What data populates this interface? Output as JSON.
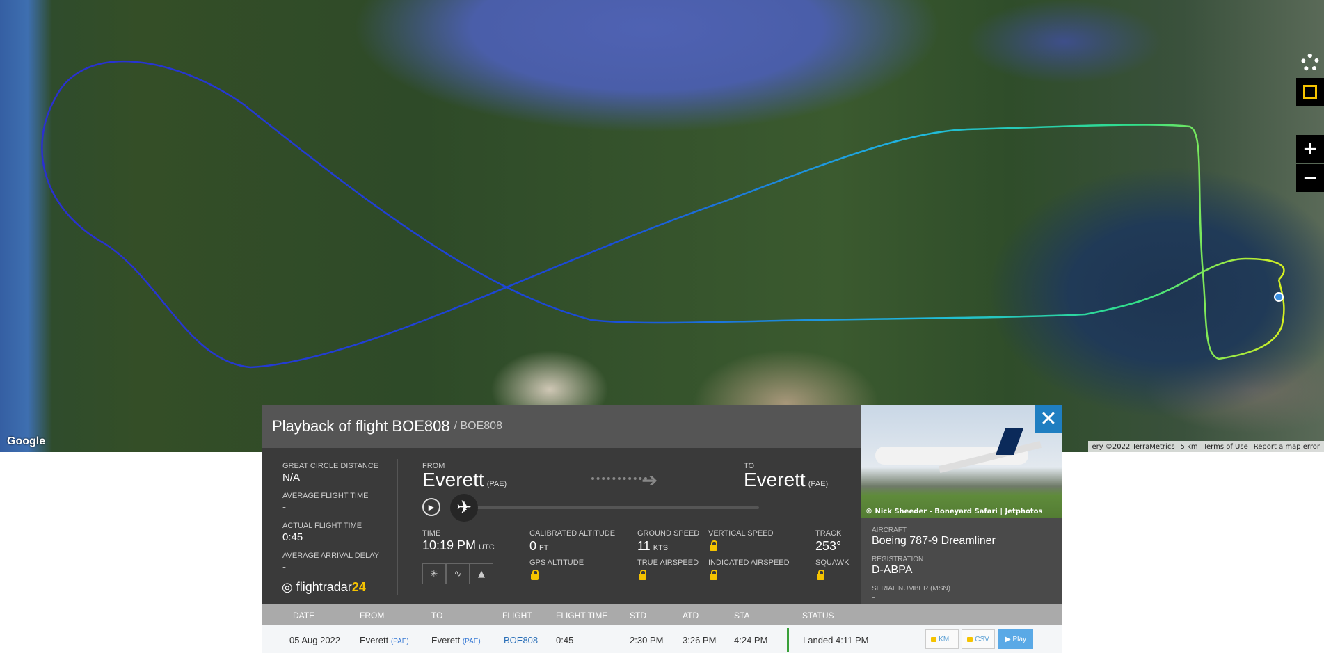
{
  "map": {
    "google_logo": "Google",
    "credits": [
      "ery ©2022 TerraMetrics",
      "5 km",
      "Terms of Use",
      "Report a map error"
    ],
    "zoom_in": "+",
    "zoom_out": "−"
  },
  "panel": {
    "title": "Playback of flight BOE808",
    "subtitle": "/ BOE808",
    "close_label": "✕",
    "stats": [
      {
        "label": "GREAT CIRCLE DISTANCE",
        "value": "N/A"
      },
      {
        "label": "AVERAGE FLIGHT TIME",
        "value": "-"
      },
      {
        "label": "ACTUAL FLIGHT TIME",
        "value": "0:45"
      },
      {
        "label": "AVERAGE ARRIVAL DELAY",
        "value": "-"
      }
    ],
    "brand": {
      "name": "flightradar",
      "number": "24"
    },
    "from": {
      "label": "FROM",
      "city": "Everett",
      "code": "(PAE)"
    },
    "to": {
      "label": "TO",
      "city": "Everett",
      "code": "(PAE)"
    },
    "time": {
      "label": "TIME",
      "value": "10:19 PM",
      "unit": "UTC"
    },
    "calibrated_altitude": {
      "label": "CALIBRATED ALTITUDE",
      "value": "0",
      "unit": "FT"
    },
    "gps_altitude": {
      "label": "GPS ALTITUDE"
    },
    "ground_speed": {
      "label": "GROUND SPEED",
      "value": "11",
      "unit": "KTS"
    },
    "true_airspeed": {
      "label": "TRUE AIRSPEED"
    },
    "vertical_speed": {
      "label": "VERTICAL SPEED"
    },
    "indicated_airspeed": {
      "label": "INDICATED AIRSPEED"
    },
    "track": {
      "label": "TRACK",
      "value": "253°"
    },
    "squawk": {
      "label": "SQUAWK"
    },
    "photo_credit": "© Nick Sheeder - Boneyard Safari | Jetphotos",
    "aircraft": {
      "label": "AIRCRAFT",
      "value": "Boeing 787-9 Dreamliner"
    },
    "registration": {
      "label": "REGISTRATION",
      "value": "D-ABPA"
    },
    "serial": {
      "label": "SERIAL NUMBER (MSN)",
      "value": "-"
    }
  },
  "table": {
    "headers": [
      "DATE",
      "FROM",
      "TO",
      "FLIGHT",
      "FLIGHT TIME",
      "STD",
      "ATD",
      "STA",
      "STATUS"
    ],
    "row": {
      "date": "05 Aug 2022",
      "from": "Everett",
      "from_code": "(PAE)",
      "to": "Everett",
      "to_code": "(PAE)",
      "flight": "BOE808",
      "flight_time": "0:45",
      "std": "2:30 PM",
      "atd": "3:26 PM",
      "sta": "4:24 PM",
      "status": "Landed 4:11 PM",
      "kml": "KML",
      "csv": "CSV",
      "play": "▶ Play"
    }
  }
}
